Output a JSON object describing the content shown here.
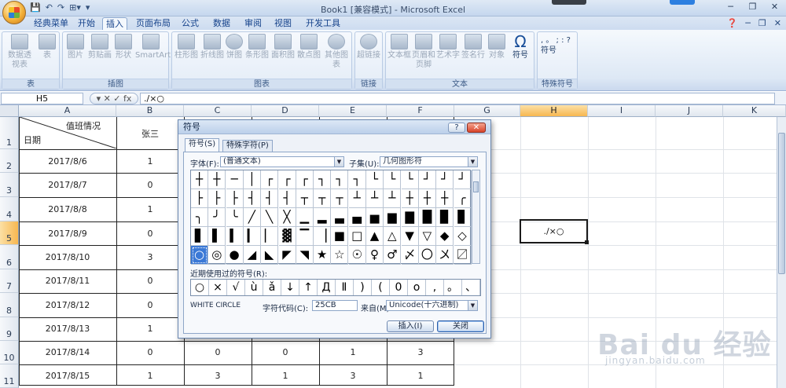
{
  "app": {
    "window_title": "Book1 [兼容模式] - Microsoft Excel",
    "quick_access": [
      "💾",
      "↶",
      "↷",
      "⊞▾",
      "▾"
    ]
  },
  "tabs": [
    {
      "label": "经典菜单"
    },
    {
      "label": "开始"
    },
    {
      "label": "插入",
      "active": true
    },
    {
      "label": "页面布局"
    },
    {
      "label": "公式"
    },
    {
      "label": "数据"
    },
    {
      "label": "审阅"
    },
    {
      "label": "视图"
    },
    {
      "label": "开发工具"
    }
  ],
  "ribbon": {
    "groups": [
      {
        "label": "表",
        "buttons": [
          "数据透视表",
          "表"
        ]
      },
      {
        "label": "插图",
        "buttons": [
          "图片",
          "剪贴画",
          "形状",
          "SmartArt"
        ]
      },
      {
        "label": "图表",
        "buttons": [
          "柱形图",
          "折线图",
          "饼图",
          "条形图",
          "面积图",
          "散点图",
          "其他图表"
        ]
      },
      {
        "label": "链接",
        "buttons": [
          "超链接"
        ]
      },
      {
        "label": "文本",
        "buttons": [
          "文本框",
          "页眉和页脚",
          "艺术字",
          "签名行",
          "对象",
          "符号"
        ]
      },
      {
        "label": "特殊符号",
        "buttons": [
          "符号"
        ]
      }
    ],
    "special_symbols": ", 。 ; : ? 符号"
  },
  "formula_bar": {
    "name_box": "H5",
    "buttons": "▾ ✕ ✓ fx",
    "formula": "./×○"
  },
  "sheet": {
    "columns": [
      "A",
      "B",
      "C",
      "D",
      "E",
      "F",
      "G",
      "H",
      "I",
      "J",
      "K"
    ],
    "selected_column": "H",
    "rows": [
      "1",
      "2",
      "3",
      "4",
      "5",
      "6",
      "7",
      "8",
      "9",
      "10",
      "11"
    ],
    "selected_row": "5",
    "header_top_right": "值班情况",
    "header_bottom_left": "日期",
    "header_b1": "张三",
    "dates": [
      "2017/8/6",
      "2017/8/7",
      "2017/8/8",
      "2017/8/9",
      "2017/8/10",
      "2017/8/11",
      "2017/8/12",
      "2017/8/13",
      "2017/8/14",
      "2017/8/15"
    ],
    "col_b": [
      "1",
      "0",
      "1",
      "0",
      "3",
      "0",
      "0",
      "1",
      "0",
      "1"
    ],
    "row10_tail": [
      "0",
      "0",
      "1",
      "3"
    ],
    "row11_tail": [
      "3",
      "1",
      "3",
      "1"
    ],
    "selected_cell_value": "./×○"
  },
  "dialog": {
    "title": "符号",
    "help": "?",
    "close": "✕",
    "tab_symbols": "符号(S)",
    "tab_special": "特殊字符(P)",
    "font_label": "字体(F):",
    "font_value": "(普通文本)",
    "subset_label": "子集(U):",
    "subset_value": "几何图形符",
    "symbol_rows": [
      [
        "┼",
        "┼",
        "─",
        "│",
        "┌",
        "┌",
        "┌",
        "┐",
        "┐",
        "┐",
        "└",
        "└",
        "└",
        "┘",
        "┘",
        "┘"
      ],
      [
        "├",
        "├",
        "├",
        "┤",
        "┤",
        "┤",
        "┬",
        "┬",
        "┬",
        "┴",
        "┴",
        "┴",
        "┼",
        "┼",
        "┼",
        "╭"
      ],
      [
        "╮",
        "╯",
        "╰",
        "╱",
        "╲",
        "╳",
        "▁",
        "▂",
        "▃",
        "▄",
        "▅",
        "▆",
        "▇",
        "█",
        "▉",
        "▊"
      ],
      [
        "▋",
        "▌",
        "▍",
        "▎",
        "▏",
        "▓",
        "▔",
        "▕",
        "■",
        "□",
        "▲",
        "△",
        "▼",
        "▽",
        "◆",
        "◇"
      ],
      [
        "○",
        "◎",
        "●",
        "◢",
        "◣",
        "◤",
        "◥",
        "★",
        "☆",
        "☉",
        "♀",
        "♂",
        "〆",
        "〇",
        "〤",
        "〼"
      ]
    ],
    "selected_symbol": "○",
    "recent_label": "近期使用过的符号(R):",
    "recent": [
      "○",
      "×",
      "√",
      "ù",
      "ǎ",
      "↓",
      "↑",
      "Д",
      "Ⅱ",
      ")",
      "(",
      "0",
      "o",
      ",",
      "。",
      "、"
    ],
    "char_name": "WHITE CIRCLE",
    "char_code_label": "字符代码(C):",
    "char_code": "25CB",
    "from_label": "来自(M):",
    "from_value": "Unicode(十六进制)",
    "insert": "插入(I)",
    "close_btn": "关闭"
  },
  "watermark": {
    "brand": "Bai du 经验",
    "url": "jingyan.baidu.com"
  }
}
